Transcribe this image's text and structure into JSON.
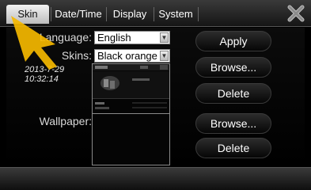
{
  "tabs": [
    {
      "label": "Skin",
      "active": true
    },
    {
      "label": "Date/Time",
      "active": false
    },
    {
      "label": "Display",
      "active": false
    },
    {
      "label": "System",
      "active": false
    }
  ],
  "close_icon": "close-x-icon",
  "form": {
    "language_label": "Language:",
    "language_value": "English",
    "skins_label": "Skins:",
    "skins_value": "Black orange *",
    "wallpaper_label": "Wallpaper:"
  },
  "datetime": {
    "date": "2013-7-29",
    "time": "10:32:14"
  },
  "buttons": {
    "apply": "Apply",
    "browse_skin": "Browse...",
    "delete_skin": "Delete",
    "browse_wallpaper": "Browse...",
    "delete_wallpaper": "Delete"
  },
  "colors": {
    "accent": "#f5b800",
    "background": "#000000",
    "text": "#ffffff"
  }
}
